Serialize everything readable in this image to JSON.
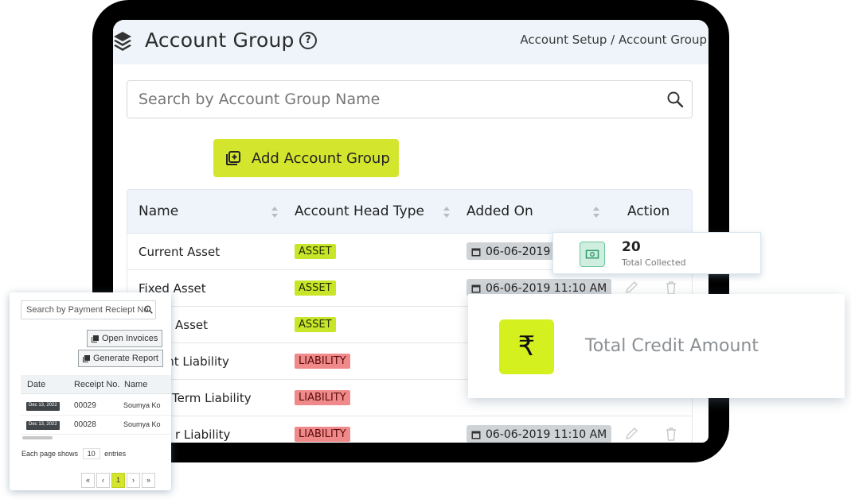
{
  "main": {
    "title": "Account Group",
    "breadcrumb": "Account Setup / Account Group",
    "search_placeholder": "Search by Account Group Name",
    "add_button": "Add Account Group",
    "table": {
      "headers": [
        "Name",
        "Account Head Type",
        "Added On",
        "Action"
      ],
      "rows": [
        {
          "name": "Current Asset",
          "type": "ASSET",
          "date": "06-06-2019"
        },
        {
          "name": "Fixed Asset",
          "type": "ASSET",
          "date": "06-06-2019 11:10 AM"
        },
        {
          "name": "Asset",
          "type": "ASSET",
          "date": ""
        },
        {
          "name": "ent Liability",
          "type": "LIABILITY",
          "date": ""
        },
        {
          "name": "Term Liability",
          "type": "LIABILITY",
          "date": ""
        },
        {
          "name": "r Liability",
          "type": "LIABILITY",
          "date": "06-06-2019 11:10 AM"
        }
      ]
    }
  },
  "collected_card": {
    "value": "20",
    "label": "Total Collected"
  },
  "credit_card": {
    "symbol": "₹",
    "label": "Total Credit Amount"
  },
  "receipt_panel": {
    "search_placeholder": "Search by Payment Reciept No",
    "open_invoices": "Open Invoices",
    "generate_report": "Generate Report",
    "headers": [
      "Date",
      "Receipt No.",
      "Name"
    ],
    "rows": [
      {
        "date": "Dec 13, 2022",
        "no": "00029",
        "name": "Soumya Ko"
      },
      {
        "date": "Dec 13, 2022",
        "no": "00028",
        "name": "Soumya Ko"
      }
    ],
    "entries_prefix": "Each page shows",
    "entries_value": "10",
    "entries_suffix": "entries",
    "pager": [
      "«",
      "‹",
      "1",
      "›",
      "»"
    ]
  },
  "colors": {
    "accent": "#d4e52e",
    "asset_badge": "#c9e52a",
    "liability_badge": "#f08a8a",
    "header_bg": "#eef4f9"
  }
}
